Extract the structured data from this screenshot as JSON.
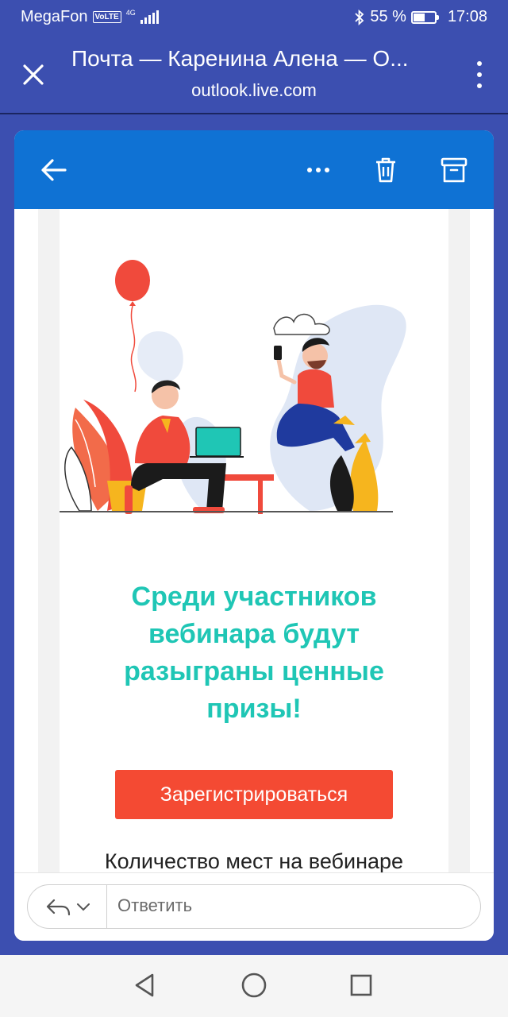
{
  "status_bar": {
    "carrier": "MegaFon",
    "volte": "VoLTE",
    "network": "4G",
    "battery_text": "55 %",
    "battery_level": 0.55,
    "time": "17:08",
    "icons": [
      "signal-icon",
      "bluetooth-icon",
      "battery-icon"
    ]
  },
  "browser": {
    "title": "Почта — Каренина Алена — О...",
    "url": "outlook.live.com",
    "icons": [
      "close-icon",
      "more-vertical-icon"
    ]
  },
  "mail_toolbar": {
    "icons": [
      "back-arrow-icon",
      "more-horizontal-icon",
      "trash-icon",
      "archive-icon"
    ]
  },
  "email": {
    "headline_lines": [
      "Среди участников",
      "вебинара будут",
      "разыграны ценные",
      "призы!"
    ],
    "cta_label": "Зарегистрироваться",
    "partial_text": "Количество мест на вебинаре"
  },
  "reply": {
    "placeholder": "Ответить",
    "icons": [
      "reply-icon",
      "chevron-down-icon"
    ]
  },
  "colors": {
    "app_bg": "#3c4fb0",
    "mail_header": "#0f72d4",
    "headline": "#1fc6b5",
    "cta": "#f44a33"
  },
  "navigation": {
    "icons": [
      "back-triangle-icon",
      "home-circle-icon",
      "recents-square-icon"
    ]
  }
}
